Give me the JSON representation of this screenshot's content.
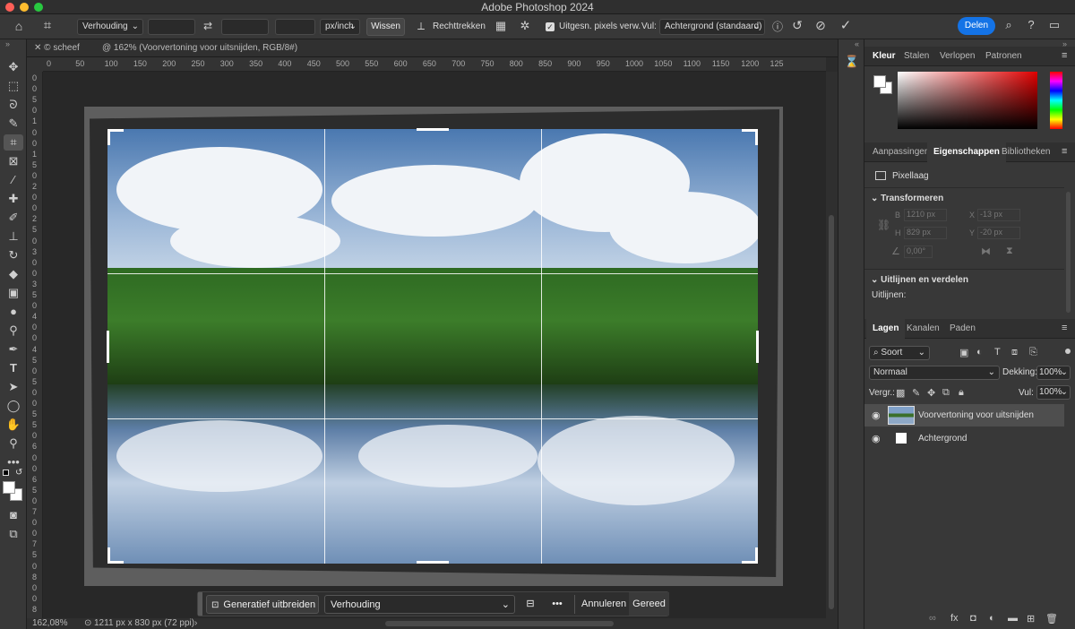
{
  "window": {
    "title": "Adobe Photoshop 2024"
  },
  "options": {
    "ratio_select": "Verhouding",
    "swap_icon": "swap-icon",
    "unit_select": "px/inch",
    "clear_button": "Wissen",
    "straighten_label": "Rechttrekken",
    "delete_pixels_label": "Uitgesn. pixels verw.",
    "delete_pixels_checked": true,
    "fill_label": "Vul:",
    "fill_select": "Achtergrond (standaard)",
    "share_button": "Delen"
  },
  "tabs": [
    {
      "label": "scheef"
    },
    {
      "label": "@ 162% (Voorvertoning voor uitsnijden, RGB/8#)"
    }
  ],
  "ruler": {
    "top": [
      "0",
      "50",
      "100",
      "150",
      "200",
      "250",
      "300",
      "350",
      "400",
      "450",
      "500",
      "550",
      "600",
      "650",
      "700",
      "750",
      "800",
      "850",
      "900",
      "950",
      "1000",
      "1050",
      "1100",
      "1150",
      "1200",
      "125"
    ],
    "left": [
      "0",
      "0",
      "5",
      "0",
      "1",
      "0",
      "0",
      "1",
      "5",
      "0",
      "2",
      "0",
      "0",
      "2",
      "5",
      "0",
      "3",
      "0",
      "0",
      "3",
      "5",
      "0",
      "4",
      "0",
      "0",
      "4",
      "5",
      "0",
      "5",
      "0",
      "0",
      "5",
      "5",
      "0",
      "6",
      "0",
      "0",
      "6",
      "5",
      "0",
      "7",
      "0",
      "0",
      "7",
      "5",
      "0",
      "8",
      "0",
      "0",
      "8"
    ]
  },
  "contextbar": {
    "generative_label": "Generatief uitbreiden",
    "ratio_select": "Verhouding",
    "cancel_label": "Annuleren",
    "done_label": "Gereed"
  },
  "status": {
    "zoom": "162,08%",
    "doc_size": "1211 px x 830 px (72 ppi)"
  },
  "color_panel": {
    "tabs": [
      "Kleur",
      "Stalen",
      "Verlopen",
      "Patronen"
    ],
    "active_tab": 0
  },
  "props_panel": {
    "tabs": [
      "Aanpassingen",
      "Eigenschappen",
      "Bibliotheken"
    ],
    "active_tab": 1,
    "layer_kind": "Pixellaag",
    "transform_heading": "Transformeren",
    "w_label": "B",
    "w_value": "1210 px",
    "h_label": "H",
    "h_value": "829 px",
    "x_label": "X",
    "x_value": "-13 px",
    "y_label": "Y",
    "y_value": "-20 px",
    "angle_value": "0,00°",
    "align_heading": "Uitlijnen en verdelen",
    "align_label": "Uitlijnen:"
  },
  "layers_panel": {
    "tabs": [
      "Lagen",
      "Kanalen",
      "Paden"
    ],
    "active_tab": 0,
    "filter_select": "Soort",
    "blend_mode": "Normaal",
    "opacity_label": "Dekking:",
    "opacity_value": "100%",
    "lock_label": "Vergr.:",
    "fill_label": "Vul:",
    "fill_value": "100%",
    "layers": [
      {
        "name": "Voorvertoning voor uitsnijden",
        "visible": true,
        "selected": true
      },
      {
        "name": "Achtergrond",
        "visible": true,
        "selected": false
      }
    ]
  },
  "colors": {
    "accent": "#1473e6",
    "panel": "#383838",
    "background": "#2b2b2b"
  }
}
